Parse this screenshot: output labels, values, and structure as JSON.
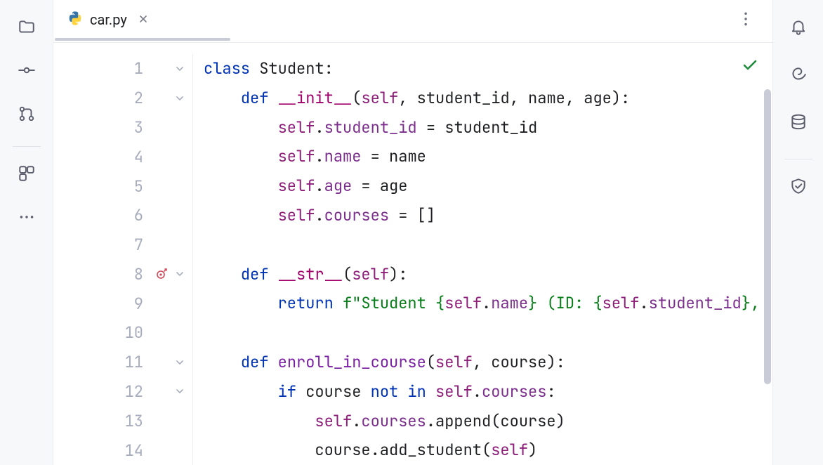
{
  "tab": {
    "filename": "car.py"
  },
  "gutter": {
    "lines": [
      "1",
      "2",
      "3",
      "4",
      "5",
      "6",
      "7",
      "8",
      "9",
      "10",
      "11",
      "12",
      "13",
      "14"
    ]
  },
  "code": {
    "line1": {
      "kw": "class",
      "sp": " ",
      "name": "Student",
      "colon": ":"
    },
    "line2": {
      "indent": "    ",
      "kw": "def",
      "sp": " ",
      "fn": "__init__",
      "open": "(",
      "self": "self",
      "args": ", student_id, name, age",
      "close": "):"
    },
    "line3": {
      "indent": "        ",
      "self": "self",
      "dot": ".",
      "attr": "student_id",
      "eq": " = student_id"
    },
    "line4": {
      "indent": "        ",
      "self": "self",
      "dot": ".",
      "attr": "name",
      "eq": " = name"
    },
    "line5": {
      "indent": "        ",
      "self": "self",
      "dot": ".",
      "attr": "age",
      "eq": " = age"
    },
    "line6": {
      "indent": "        ",
      "self": "self",
      "dot": ".",
      "attr": "courses",
      "eq": " = []"
    },
    "line7": {
      "blank": ""
    },
    "line8": {
      "indent": "    ",
      "kw": "def",
      "sp": " ",
      "fn": "__str__",
      "open": "(",
      "self": "self",
      "close": "):"
    },
    "line9a": {
      "indent": "        ",
      "kw": "return",
      "sp": " "
    },
    "line9b": {
      "fopen": "f\"Student {",
      "self1": "self",
      "dot1": ".",
      "attr1": "name",
      "mid": "} (ID: {",
      "self2": "self",
      "dot2": ".",
      "attr2": "student_id",
      "end": "},"
    },
    "line10": {
      "blank": ""
    },
    "line11": {
      "indent": "    ",
      "kw": "def",
      "sp": " ",
      "fn": "enroll_in_course",
      "open": "(",
      "self": "self",
      "args": ", course",
      "close": "):"
    },
    "line12": {
      "indent": "        ",
      "kw1": "if",
      "mid": " course ",
      "kw2": "not in",
      "sp": " ",
      "self": "self",
      "dot": ".",
      "attr": "courses",
      "colon": ":"
    },
    "line13": {
      "indent": "            ",
      "self": "self",
      "dot": ".",
      "attr": "courses",
      "call": ".append(course)"
    },
    "line14": {
      "indent": "            course.add_student(",
      "self": "self",
      "close": ")"
    }
  },
  "icons": {
    "folder": "folder-icon",
    "vcs_commit": "commit-icon",
    "pull_requests": "pull-requests-icon",
    "structure": "structure-icon",
    "more": "more-icon",
    "notifications": "bell-icon",
    "ai": "spiral-icon",
    "database": "database-icon",
    "shield": "shield-check-icon",
    "tab_more": "vertical-dots-icon",
    "python": "python-icon",
    "close": "close-icon",
    "fold": "chevron-down-icon",
    "inline_marker": "target-arrow-icon",
    "analysis_ok": "checkmark-icon"
  }
}
